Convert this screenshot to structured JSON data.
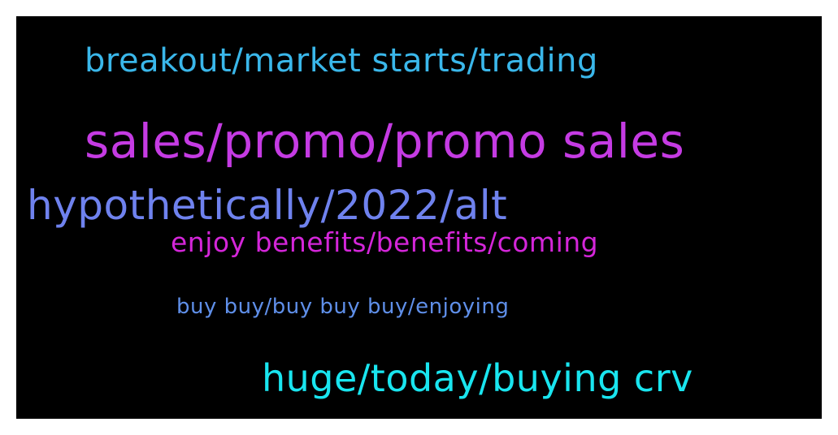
{
  "wordcloud": {
    "background": "#000000",
    "phrases": [
      {
        "text": "breakout/market starts/trading",
        "color": "#3ab7ea"
      },
      {
        "text": "sales/promo/promo sales",
        "color": "#c53be3"
      },
      {
        "text": "hypothetically/2022/alt",
        "color": "#6f82ee"
      },
      {
        "text": "enjoy benefits/benefits/coming",
        "color": "#d426d9"
      },
      {
        "text": "buy buy/buy buy buy/enjoying",
        "color": "#5f8fe9"
      },
      {
        "text": "huge/today/buying crv",
        "color": "#19e5ef"
      }
    ]
  }
}
